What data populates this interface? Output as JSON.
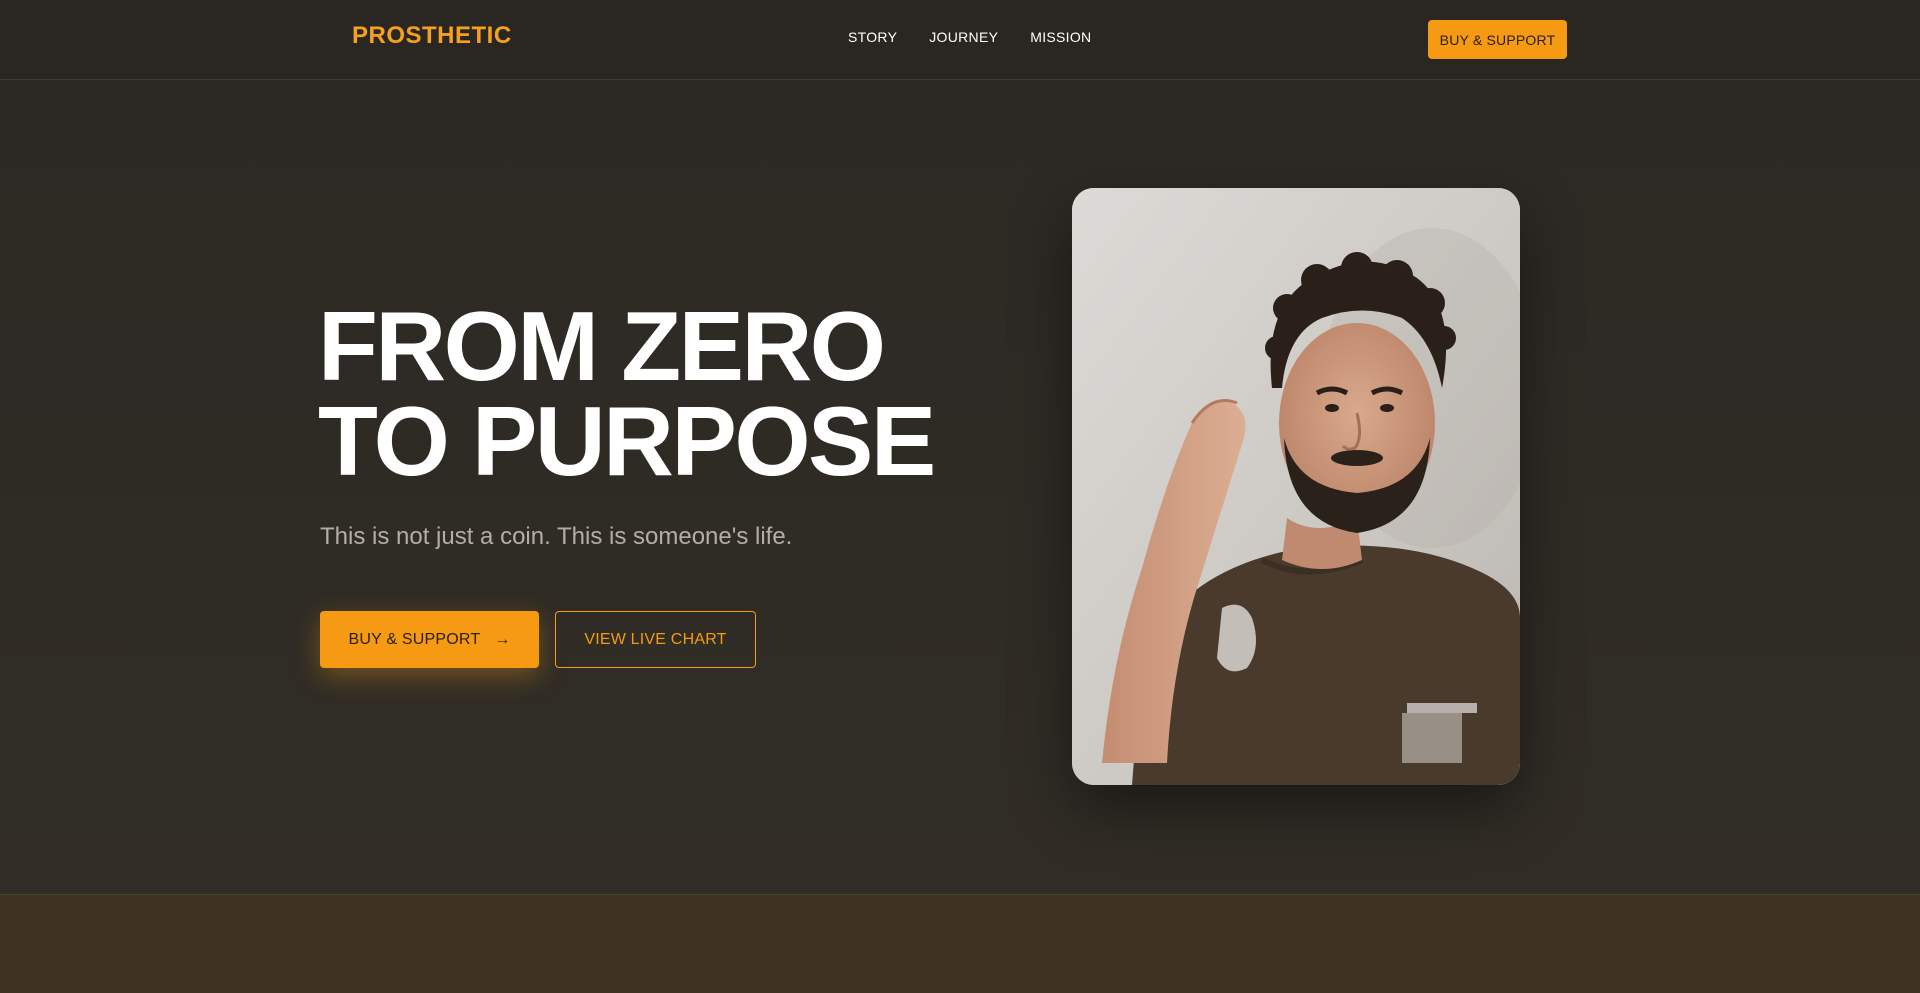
{
  "header": {
    "logo": "PROSTHETIC",
    "nav": [
      {
        "label": "STORY"
      },
      {
        "label": "JOURNEY"
      },
      {
        "label": "MISSION"
      }
    ],
    "cta_label": "BUY & SUPPORT"
  },
  "hero": {
    "title_line1": "FROM ZERO",
    "title_line2": "TO PURPOSE",
    "subtitle": "This is not just a coin. This is someone's life.",
    "primary_cta": "BUY & SUPPORT",
    "primary_cta_icon": "arrow-right-icon",
    "secondary_cta": "VIEW LIVE CHART",
    "photo_alt": "Portrait photo"
  },
  "colors": {
    "accent": "#f59a12",
    "background": "#2b2823",
    "next_section": "#3d3222"
  }
}
